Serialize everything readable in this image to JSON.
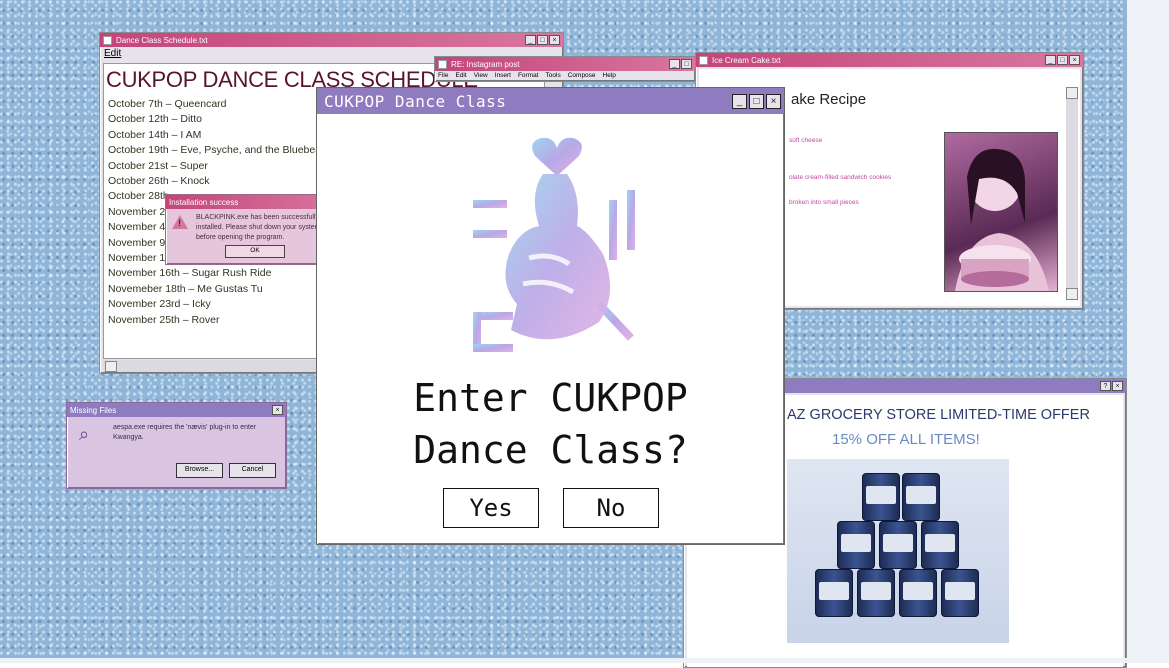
{
  "schedule_window": {
    "title": "Dance Class Schedule.txt",
    "menu": "Edit",
    "heading": "CUKPOP DANCE CLASS SCHEDULE",
    "items": [
      "October 7th – Queencard",
      "October 12th – Ditto",
      "October 14th – I AM",
      "October 19th – Eve, Psyche, and the Bluebeard's wife",
      "October 21st – Super",
      "October 26th – Knock",
      "October 28th",
      "November 2n",
      "November 4t",
      "November 9t",
      "November 11",
      "November 16th – Sugar Rush Ride",
      "Novemeber 18th – Me Gustas Tu",
      "November 23rd – Icky",
      "November 25th – Rover"
    ]
  },
  "install_dialog": {
    "title": "Installation success",
    "message": "BLACKPINK.exe has been successfully installed. Please shut down your system before opening the program.",
    "ok_label": "OK"
  },
  "ig_window": {
    "title": "RE: Instagram post",
    "menu": [
      "File",
      "Edit",
      "View",
      "Insert",
      "Format",
      "Tools",
      "Compose",
      "Help"
    ]
  },
  "icecream_window": {
    "title": "Ice Cream Cake.txt",
    "heading": "ake Recipe",
    "ingredients": [
      "soft cheese",
      "olate cream-filled sandwich cookies",
      "broken into small pieces"
    ]
  },
  "grocery_window": {
    "offer_line1": "AZ GROCERY STORE LIMITED-TIME OFFER",
    "offer_line2": "15% OFF ALL ITEMS!"
  },
  "missing_dialog": {
    "title": "Missing Files",
    "message": "aespa.exe requires the 'nævis' plug-in to enter Kwangya.",
    "browse_label": "Browse...",
    "cancel_label": "Cancel"
  },
  "main_dialog": {
    "title": "CUKPOP Dance Class",
    "question_line1": "Enter CUKPOP",
    "question_line2": "Dance Class?",
    "yes_label": "Yes",
    "no_label": "No"
  },
  "colors": {
    "accent_purple": "#8f7bc0",
    "accent_pink": "#c4457b",
    "background_blue": "#8fb6d9"
  }
}
